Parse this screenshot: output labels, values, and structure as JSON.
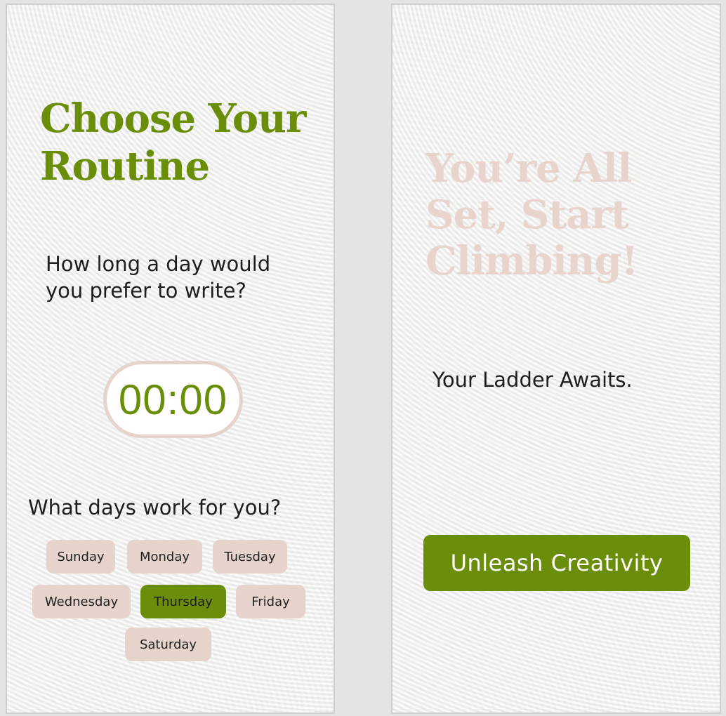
{
  "routine_screen": {
    "title": "Choose Your Routine",
    "duration_question": "How long a day would you prefer to write?",
    "timer_value": "00:00",
    "days_question": "What days work for you?",
    "days": [
      {
        "label": "Sunday",
        "selected": false
      },
      {
        "label": "Monday",
        "selected": false
      },
      {
        "label": "Tuesday",
        "selected": false
      },
      {
        "label": "Wednesday",
        "selected": false
      },
      {
        "label": "Thursday",
        "selected": true
      },
      {
        "label": "Friday",
        "selected": false
      },
      {
        "label": "Saturday",
        "selected": false
      }
    ]
  },
  "finish_screen": {
    "title": "You’re All Set, Start Climbing!",
    "subtitle": "Your Ladder Awaits.",
    "cta_label": "Unleash Creativity"
  },
  "colors": {
    "accent_green": "#6b8e0a",
    "chip_blush": "#e6d3cc",
    "faded_title": "#e9d4cd",
    "text_dark": "#1e1e1e"
  }
}
